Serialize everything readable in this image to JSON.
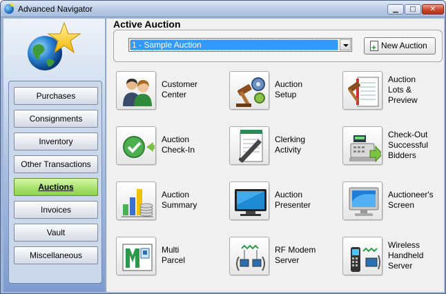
{
  "window": {
    "title": "Advanced Navigator",
    "min_symbol": "▁",
    "max_symbol": "□",
    "close_symbol": "✕"
  },
  "sidebar": {
    "items": [
      {
        "label": "Purchases",
        "active": false
      },
      {
        "label": "Consignments",
        "active": false
      },
      {
        "label": "Inventory",
        "active": false
      },
      {
        "label": "Other Transactions",
        "active": false
      },
      {
        "label": "Auctions",
        "active": true
      },
      {
        "label": "Invoices",
        "active": false
      },
      {
        "label": "Vault",
        "active": false
      },
      {
        "label": "Miscellaneous",
        "active": false
      }
    ]
  },
  "main": {
    "heading": "Active Auction",
    "auction_select": {
      "selected": "1 - Sample Auction"
    },
    "new_auction_label": "New Auction",
    "tiles": [
      {
        "label": "Customer\nCenter",
        "icon": "customers-icon"
      },
      {
        "label": "Auction\nSetup",
        "icon": "gavel-gears-icon"
      },
      {
        "label": "Auction\nLots &\nPreview",
        "icon": "gavel-notebook-icon"
      },
      {
        "label": "Auction\nCheck-In",
        "icon": "checkmark-arrow-icon"
      },
      {
        "label": "Clerking\nActivity",
        "icon": "pen-paper-icon"
      },
      {
        "label": "Check-Out\nSuccessful\nBidders",
        "icon": "cash-register-icon"
      },
      {
        "label": "Auction\nSummary",
        "icon": "bar-chart-coins-icon"
      },
      {
        "label": "Auction\nPresenter",
        "icon": "widescreen-monitor-icon"
      },
      {
        "label": "Auctioneer's\nScreen",
        "icon": "lcd-monitor-icon"
      },
      {
        "label": "Multi\nParcel",
        "icon": "multi-parcel-icon"
      },
      {
        "label": "RF Modem\nServer",
        "icon": "rf-modem-icon"
      },
      {
        "label": "Wireless\nHandheld\nServer",
        "icon": "handheld-device-icon"
      }
    ]
  },
  "colors": {
    "sidebar_active": "#a5e16a",
    "selection": "#3399ff",
    "close_button": "#c9452c"
  }
}
